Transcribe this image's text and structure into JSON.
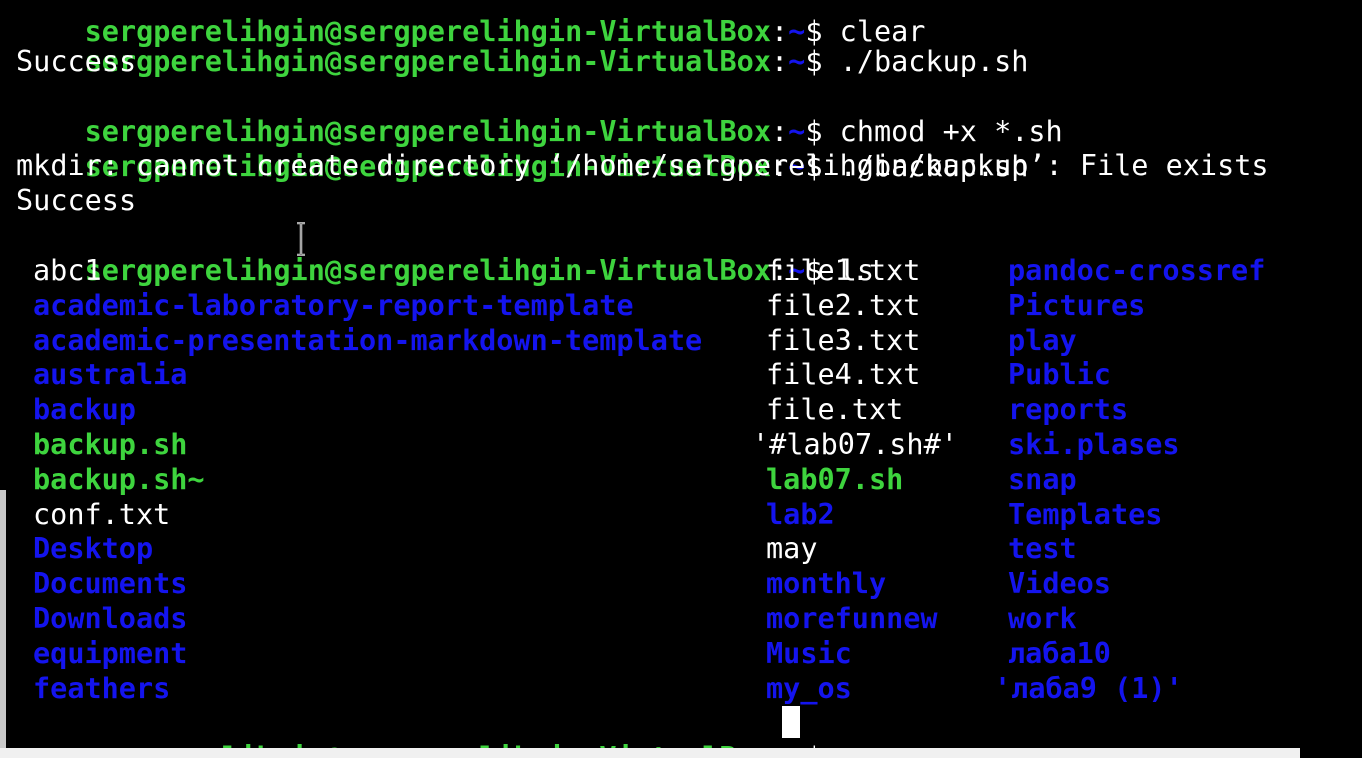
{
  "terminal": {
    "prompt_user": "sergperelihgin@sergperelihgin-VirtualBox",
    "prompt_sep": ":",
    "prompt_path": "~",
    "prompt_dollar": "$",
    "top_partial": "sergperelihgin@sergperelihgin-VirtualBox:~$ clear",
    "lines": [
      {
        "cmd": " ./backup.sh"
      },
      {
        "text": "Success"
      },
      {
        "cmd": " chmod +x *.sh"
      },
      {
        "cmd": " ./backup.sh"
      },
      {
        "text": "mkdir: cannot create directory ‘/home/sergperelihgin/backup’: File exists"
      },
      {
        "text": "Success"
      },
      {
        "cmd": " ls"
      }
    ],
    "ls_col1": [
      {
        "name": "abc1",
        "kind": "file"
      },
      {
        "name": "academic-laboratory-report-template",
        "kind": "dir"
      },
      {
        "name": "academic-presentation-markdown-template",
        "kind": "dir"
      },
      {
        "name": "australia",
        "kind": "dir"
      },
      {
        "name": "backup",
        "kind": "dir"
      },
      {
        "name": "backup.sh",
        "kind": "exec"
      },
      {
        "name": "backup.sh~",
        "kind": "exec"
      },
      {
        "name": "conf.txt",
        "kind": "file"
      },
      {
        "name": "Desktop",
        "kind": "dir"
      },
      {
        "name": "Documents",
        "kind": "dir"
      },
      {
        "name": "Downloads",
        "kind": "dir"
      },
      {
        "name": "equipment",
        "kind": "dir"
      },
      {
        "name": "feathers",
        "kind": "dir"
      }
    ],
    "ls_col2": [
      {
        "name": "file1.txt",
        "kind": "file"
      },
      {
        "name": "file2.txt",
        "kind": "file"
      },
      {
        "name": "file3.txt",
        "kind": "file"
      },
      {
        "name": "file4.txt",
        "kind": "file"
      },
      {
        "name": "file.txt",
        "kind": "file"
      },
      {
        "name": "'#lab07.sh#'",
        "kind": "file"
      },
      {
        "name": "lab07.sh",
        "kind": "exec"
      },
      {
        "name": "lab2",
        "kind": "dir"
      },
      {
        "name": "may",
        "kind": "file"
      },
      {
        "name": "monthly",
        "kind": "dir"
      },
      {
        "name": "morefunnew",
        "kind": "dir"
      },
      {
        "name": "Music",
        "kind": "dir"
      },
      {
        "name": "my_os",
        "kind": "dir"
      }
    ],
    "ls_col3": [
      {
        "name": "pandoc-crossref",
        "kind": "dir"
      },
      {
        "name": "Pictures",
        "kind": "dir"
      },
      {
        "name": "play",
        "kind": "dir"
      },
      {
        "name": "Public",
        "kind": "dir"
      },
      {
        "name": "reports",
        "kind": "dir"
      },
      {
        "name": "ski.plases",
        "kind": "dir"
      },
      {
        "name": "snap",
        "kind": "dir"
      },
      {
        "name": "Templates",
        "kind": "dir"
      },
      {
        "name": "test",
        "kind": "dir"
      },
      {
        "name": "Videos",
        "kind": "dir"
      },
      {
        "name": "work",
        "kind": "dir"
      },
      {
        "name": "лаба10",
        "kind": "dir"
      },
      {
        "name": "'лаба9 (1)'",
        "kind": "dir"
      }
    ],
    "colors": {
      "background": "#000000",
      "prompt_green": "#3ed43e",
      "directory_blue": "#1414ee",
      "text_white": "#ffffff"
    }
  }
}
